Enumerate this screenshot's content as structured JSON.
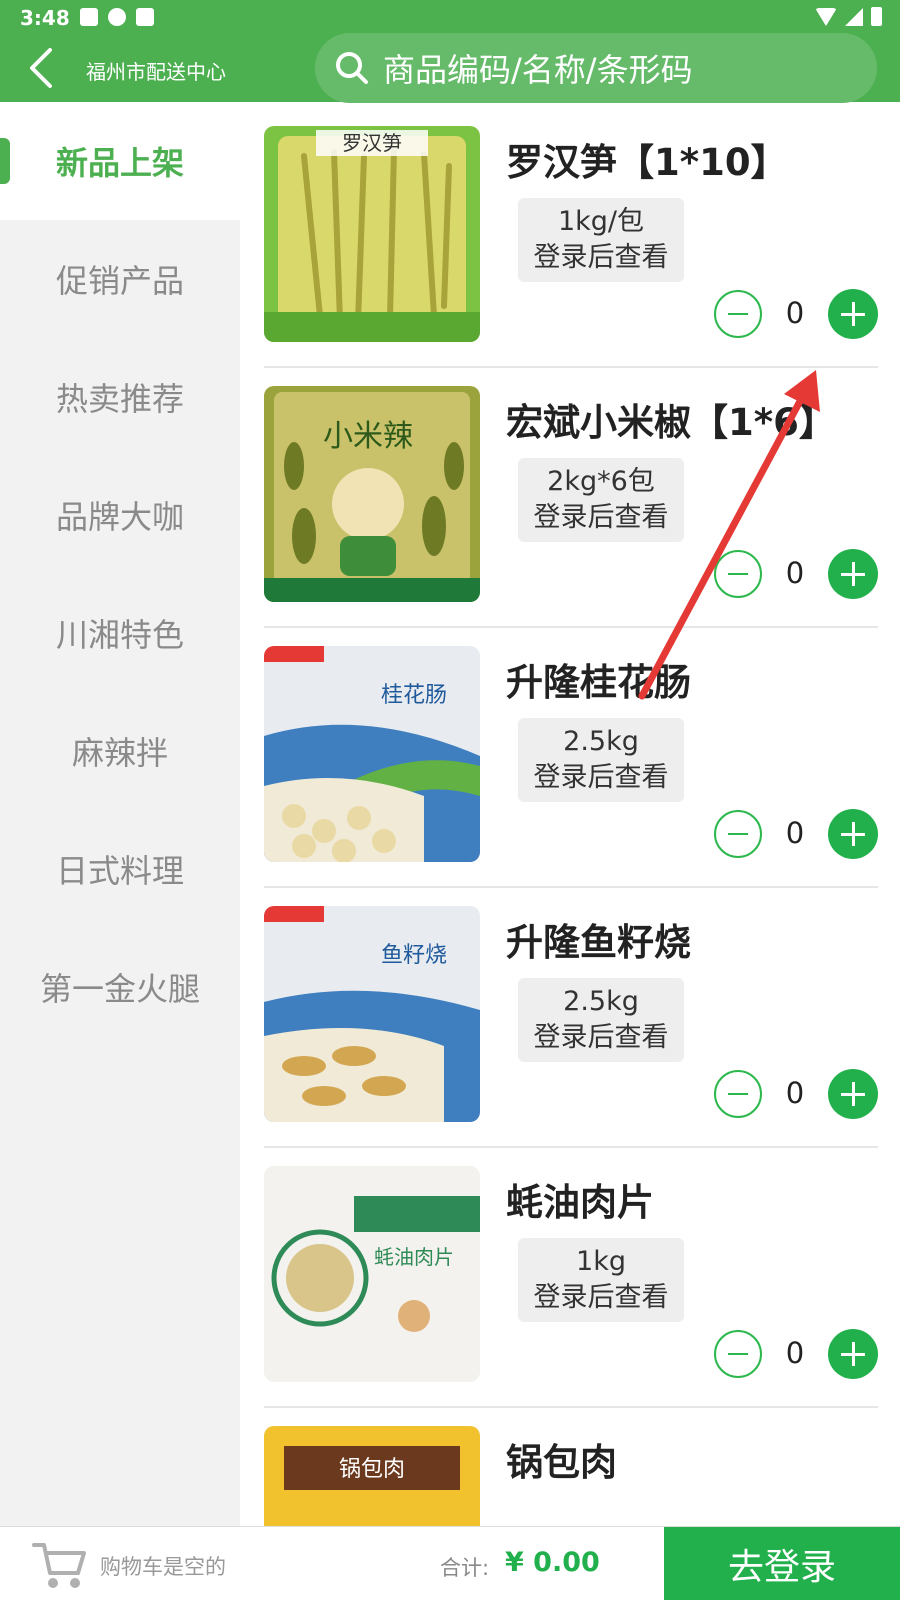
{
  "status_bar": {
    "time": "3:48",
    "icons_left": [
      "image-icon",
      "alert-icon",
      "a-box-icon"
    ],
    "icons_right": [
      "wifi-icon",
      "signal-icon",
      "battery-icon"
    ]
  },
  "header": {
    "title": "福州市配送中心",
    "search_placeholder": "商品编码/名称/条形码",
    "bg_color": "#4caf50"
  },
  "sidebar": {
    "items": [
      {
        "label": "新品上架",
        "active": true
      },
      {
        "label": "促销产品",
        "active": false
      },
      {
        "label": "热卖推荐",
        "active": false
      },
      {
        "label": "品牌大咖",
        "active": false
      },
      {
        "label": "川湘特色",
        "active": false
      },
      {
        "label": "麻辣拌",
        "active": false
      },
      {
        "label": "日式料理",
        "active": false
      },
      {
        "label": "第一金火腿",
        "active": false
      }
    ]
  },
  "products": [
    {
      "name": "罗汉笋【1*10】",
      "spec": "1kg/包",
      "price_note": "登录后查看",
      "qty": "0",
      "image_text": "罗汉笋",
      "image_color": "#7cc243"
    },
    {
      "name": "宏斌小米椒【1*6】",
      "spec": "2kg*6包",
      "price_note": "登录后查看",
      "qty": "0",
      "image_text": "小米辣",
      "image_color": "#9aa33c"
    },
    {
      "name": "升隆桂花肠",
      "spec": "2.5kg",
      "price_note": "登录后查看",
      "qty": "0",
      "image_text": "桂花肠",
      "image_color": "#4a88c8"
    },
    {
      "name": "升隆鱼籽烧",
      "spec": "2.5kg",
      "price_note": "登录后查看",
      "qty": "0",
      "image_text": "鱼籽烧",
      "image_color": "#4a88c8"
    },
    {
      "name": "蚝油肉片",
      "spec": "1kg",
      "price_note": "登录后查看",
      "qty": "0",
      "image_text": "蚝油肉片",
      "image_color": "#2e8b57"
    },
    {
      "name": "锅包肉",
      "spec": "",
      "price_note": "",
      "qty": "",
      "image_text": "锅包肉",
      "image_color": "#f2c12e"
    }
  ],
  "bottom_bar": {
    "cart_empty": "购物车是空的",
    "total_label": "合计:",
    "total_value": "¥ 0.00",
    "login_button": "去登录",
    "accent_color": "#21b04b"
  }
}
